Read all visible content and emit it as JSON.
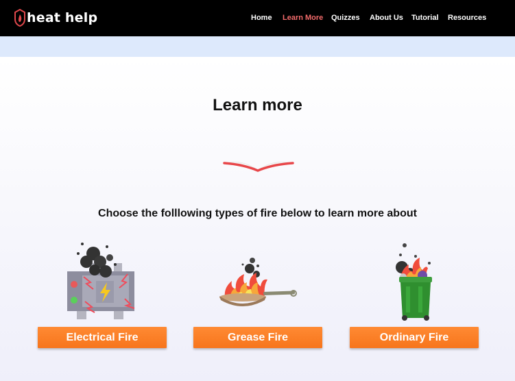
{
  "brand": {
    "name": "heat help",
    "icon": "shield-flame-icon"
  },
  "nav": {
    "items": [
      {
        "label": "Home",
        "active": false
      },
      {
        "label": "Learn More",
        "active": true
      },
      {
        "label": "Quizzes",
        "active": false
      },
      {
        "label": "About Us",
        "active": false
      },
      {
        "label": "Tutorial",
        "active": false
      },
      {
        "label": "Resources",
        "active": false
      }
    ]
  },
  "main": {
    "title": "Learn more",
    "icon": "open-book-icon",
    "subtitle": "Choose the folllowing types of fire below to learn more about",
    "fires": [
      {
        "label": "Electrical Fire",
        "icon": "electrical-fire-icon"
      },
      {
        "label": "Grease Fire",
        "icon": "grease-fire-pan-icon"
      },
      {
        "label": "Ordinary Fire",
        "icon": "trash-bin-fire-icon"
      }
    ]
  },
  "colors": {
    "nav_bg": "#000000",
    "nav_active": "#f36b6b",
    "banner": "#dde9fc",
    "button": "#f7751c",
    "book": "#e8474a"
  }
}
